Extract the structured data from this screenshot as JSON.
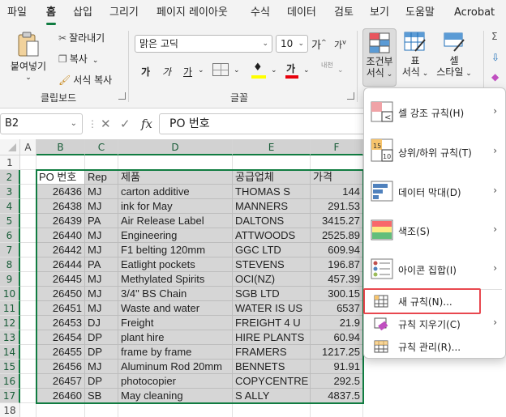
{
  "menubar": {
    "tabs": [
      "파일",
      "홈",
      "삽입",
      "그리기",
      "페이지 레이아웃",
      "수식",
      "데이터",
      "검토",
      "보기",
      "도움말",
      "Acrobat"
    ],
    "active_tab": "홈"
  },
  "ribbon": {
    "clipboard": {
      "paste_label": "붙여넣기",
      "cut_label": "잘라내기",
      "copy_label": "복사",
      "format_painter_label": "서식 복사",
      "group_label": "클립보드"
    },
    "font": {
      "font_name": "맑은 고딕",
      "font_size": "10",
      "grow_label": "가",
      "shrink_label": "가",
      "bold_label": "가",
      "italic_label": "가",
      "underline_label": "가",
      "font_color_label": "가",
      "phonetic_label": "내천",
      "group_label": "글꼴",
      "fill_color": "#ffff00",
      "font_color": "#e8000b"
    },
    "styles": {
      "conditional_label_line1": "조건부",
      "conditional_label_line2": "서식",
      "table_label_line1": "표",
      "table_label_line2": "서식",
      "cell_label_line1": "셀",
      "cell_label_line2": "스타일"
    }
  },
  "formula_bar": {
    "name_box": "B2",
    "fx": "fx",
    "formula": "PO 번호"
  },
  "sheet": {
    "columns": [
      "A",
      "B",
      "C",
      "D",
      "E",
      "F"
    ],
    "rows": [
      {
        "num": "1",
        "cells": [
          "",
          "",
          "",
          "",
          "",
          ""
        ]
      },
      {
        "num": "2",
        "cells": [
          "",
          "PO 번호",
          "Rep",
          "제품",
          "공급업체",
          "가격"
        ]
      },
      {
        "num": "3",
        "cells": [
          "",
          "26436",
          "MJ",
          "carton additive",
          "THOMAS S",
          "144"
        ]
      },
      {
        "num": "4",
        "cells": [
          "",
          "26438",
          "MJ",
          "ink for May",
          "MANNERS",
          "291.53"
        ]
      },
      {
        "num": "5",
        "cells": [
          "",
          "26439",
          "PA",
          "Air Release Label",
          "DALTONS",
          "3415.27"
        ]
      },
      {
        "num": "6",
        "cells": [
          "",
          "26440",
          "MJ",
          "Engineering",
          "ATTWOODS",
          "2525.89"
        ]
      },
      {
        "num": "7",
        "cells": [
          "",
          "26442",
          "MJ",
          "F1 belting 120mm",
          "GGC LTD",
          "609.94"
        ]
      },
      {
        "num": "8",
        "cells": [
          "",
          "26444",
          "PA",
          "Eatlight pockets",
          "STEVENS",
          "196.87"
        ]
      },
      {
        "num": "9",
        "cells": [
          "",
          "26445",
          "MJ",
          "Methylated Spirits",
          "OCI(NZ)",
          "457.39"
        ]
      },
      {
        "num": "10",
        "cells": [
          "",
          "26450",
          "MJ",
          "3/4\" BS Chain",
          "SGB LTD",
          "300.15"
        ]
      },
      {
        "num": "11",
        "cells": [
          "",
          "26451",
          "MJ",
          "Waste and water",
          "WATER IS US",
          "6537"
        ]
      },
      {
        "num": "12",
        "cells": [
          "",
          "26453",
          "DJ",
          "Freight",
          "FREIGHT 4 U",
          "21.9"
        ]
      },
      {
        "num": "13",
        "cells": [
          "",
          "26454",
          "DP",
          "plant hire",
          "HIRE PLANTS",
          "60.94"
        ]
      },
      {
        "num": "14",
        "cells": [
          "",
          "26455",
          "DP",
          "frame by frame",
          "FRAMERS",
          "1217.25"
        ]
      },
      {
        "num": "15",
        "cells": [
          "",
          "26456",
          "MJ",
          "Aluminum Rod 20mm",
          "BENNETS",
          "91.91"
        ]
      },
      {
        "num": "16",
        "cells": [
          "",
          "26457",
          "DP",
          "photocopier",
          "COPYCENTRE",
          "292.5"
        ]
      },
      {
        "num": "17",
        "cells": [
          "",
          "26460",
          "SB",
          "May cleaning",
          "S ALLY",
          "4837.5"
        ]
      },
      {
        "num": "18",
        "cells": [
          "",
          "",
          "",
          "",
          "",
          ""
        ]
      }
    ]
  },
  "cf_menu": {
    "items": [
      {
        "label": "셀 강조 규칙(H)",
        "has_submenu": true
      },
      {
        "label": "상위/하위 규칙(T)",
        "has_submenu": true
      },
      {
        "label": "데이터 막대(D)",
        "has_submenu": true
      },
      {
        "label": "색조(S)",
        "has_submenu": true
      },
      {
        "label": "아이콘 집합(I)",
        "has_submenu": true
      },
      {
        "label": "새 규칙(N)...",
        "has_submenu": false,
        "highlighted": true
      },
      {
        "label": "규칙 지우기(C)",
        "has_submenu": true
      },
      {
        "label": "규칙 관리(R)...",
        "has_submenu": false
      }
    ],
    "icon_15": "15",
    "icon_10": "10",
    "highlight_color": "#e8474f"
  },
  "colors": {
    "accent": "#107c41",
    "selection_fill": "#d6d6d6"
  }
}
